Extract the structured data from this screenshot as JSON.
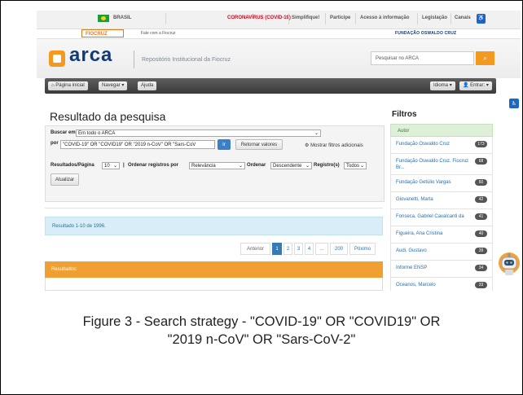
{
  "gov_bar": {
    "country": "BRASIL",
    "covid": "CORONAVÍRUS (COVID-19)",
    "links": [
      "Simplifique!",
      "Participe",
      "Acesso à informação",
      "Legislação",
      "Canais"
    ],
    "covid_color": "#d0021b"
  },
  "fiocruz_bar": {
    "logo": "FIOCRUZ",
    "contact": "Fale com a Fiocruz",
    "foundation": "FUNDAÇÃO OSWALDO CRUZ"
  },
  "header": {
    "brand": "arca",
    "subtitle": "Repositório Institucional da Fiocruz",
    "search_placeholder": "Pesquisar no ARCA",
    "accent": "#f39a1e"
  },
  "nav": {
    "home": "Página inicial",
    "browse": "Navegar",
    "help": "Ajuda",
    "language": "Idioma",
    "login": "Entrar:"
  },
  "main": {
    "title": "Resultado da pesquisa",
    "search_in_label": "Buscar em:",
    "search_in_value": "Em todo o ARCA",
    "query_label": "por",
    "query_value": "\"COVID-19\" OR \"COVID19\" OR \"2019 n-CoV\" OR \"Sars-CoV",
    "go_button": "Ir",
    "return_values": "Retornar valores",
    "show_filters": "Mostrar filtros adicionais",
    "rpp_label": "Resultados/Página",
    "rpp_value": "10",
    "sort_label": "Ordenar registros por",
    "sort_value": "Relevância",
    "order_label": "Ordenar",
    "order_value": "Descendente",
    "records_label": "Registro(s)",
    "records_value": "Todos",
    "update_button": "Atualizar",
    "result_summary": "Resultado 1-10 de 1996.",
    "results_label": "Resultados:"
  },
  "pagination": {
    "prev": "Anterior",
    "pages": [
      "1",
      "2",
      "3",
      "4",
      "...",
      "200"
    ],
    "next": "Póximo"
  },
  "filters": {
    "title": "Filtros",
    "header": "Autor",
    "items": [
      {
        "label": "Fundação Oswaldo Cruz",
        "count": "173"
      },
      {
        "label": "Fundação Oswaldo Cruz. Fiocruz Br...",
        "count": "68"
      },
      {
        "label": "Fundação Getúlio Vargas",
        "count": "60"
      },
      {
        "label": "Giovanetti, Marta",
        "count": "42"
      },
      {
        "label": "Fonseca, Gabriel Cavalcanti da",
        "count": "41"
      },
      {
        "label": "Figueira, Ana Cristina",
        "count": "40"
      },
      {
        "label": "Audi, Gustavo",
        "count": "39"
      },
      {
        "label": "Informe ENSP",
        "count": "34"
      },
      {
        "label": "Oceanos, Marcelo",
        "count": "33"
      }
    ]
  },
  "caption": {
    "line1": "Figure 3 - Search strategy - \"COVID-19\" OR \"COVID19\" OR",
    "line2": "\"2019 n-CoV\" OR \"Sars-CoV-2\""
  }
}
